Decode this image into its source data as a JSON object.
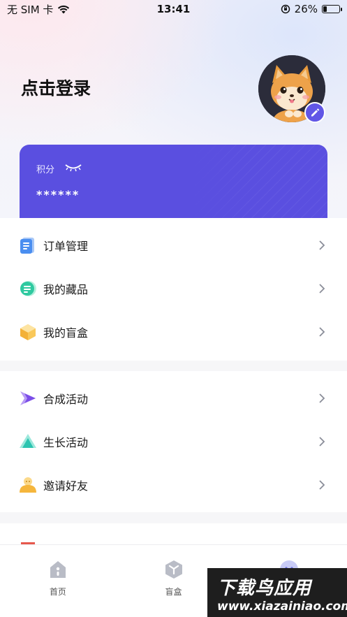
{
  "status_bar": {
    "carrier": "无 SIM 卡",
    "time": "13:41",
    "battery": "26%",
    "battery_level": 0.26
  },
  "header": {
    "login_text": "点击登录"
  },
  "points_card": {
    "label": "积分",
    "value": "******",
    "accent": "#5a4fe0"
  },
  "menu_groups": [
    {
      "items": [
        {
          "label": "订单管理",
          "icon": "order-list-icon"
        },
        {
          "label": "我的藏品",
          "icon": "collection-icon"
        },
        {
          "label": "我的盲盒",
          "icon": "blind-box-icon"
        }
      ]
    },
    {
      "items": [
        {
          "label": "合成活动",
          "icon": "synthesis-icon"
        },
        {
          "label": "生长活动",
          "icon": "growth-icon"
        },
        {
          "label": "邀请好友",
          "icon": "invite-friend-icon"
        }
      ]
    }
  ],
  "tab_bar": {
    "tabs": [
      {
        "label": "首页",
        "icon": "home-icon"
      },
      {
        "label": "盲盒",
        "icon": "box-icon"
      },
      {
        "label": "",
        "icon": "profile-icon"
      }
    ]
  },
  "watermark": {
    "top": "下载鸟应用",
    "bottom": "www.xiazainiao.com"
  }
}
